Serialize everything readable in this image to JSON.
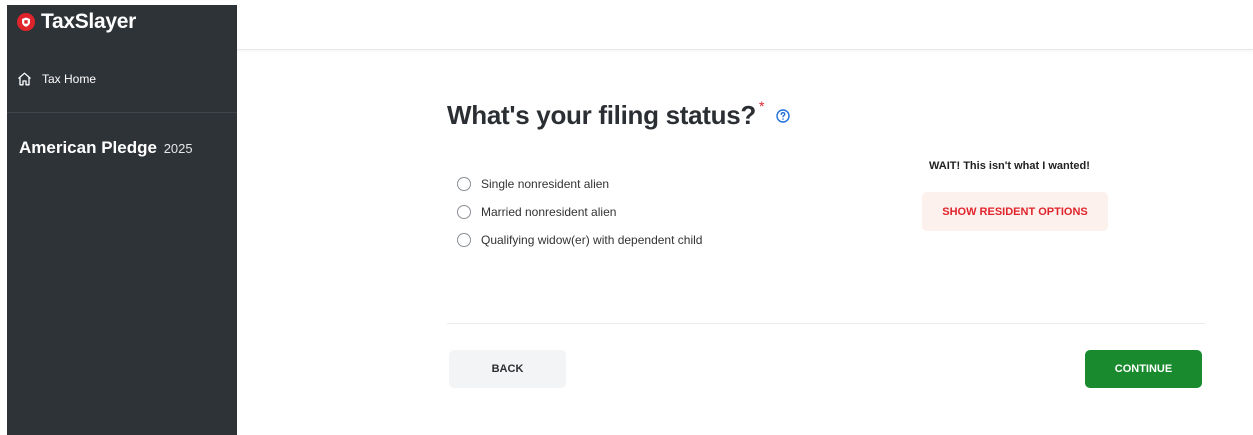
{
  "app": {
    "brand_name": "TaxSlayer",
    "logo_icon": "taxslayer-logo-icon",
    "brand_color": "#e0242b"
  },
  "sidebar": {
    "background": "#2e3338",
    "home_label": "Tax Home",
    "home_icon": "home-icon",
    "account_name": "American Pledge",
    "account_year": "2025"
  },
  "main": {
    "title": "What's your filing status?",
    "required_marker": "*",
    "help_icon": "question-circle-icon",
    "options": [
      {
        "label": "Single nonresident alien",
        "selected": false
      },
      {
        "label": "Married nonresident alien",
        "selected": false
      },
      {
        "label": "Qualifying widow(er) with dependent child",
        "selected": false
      }
    ],
    "wait_text": "WAIT! This isn't what I wanted!",
    "resident_button_label": "SHOW RESIDENT OPTIONS"
  },
  "footer": {
    "back_label": "BACK",
    "continue_label": "CONTINUE",
    "continue_color": "#1a8a2e"
  }
}
